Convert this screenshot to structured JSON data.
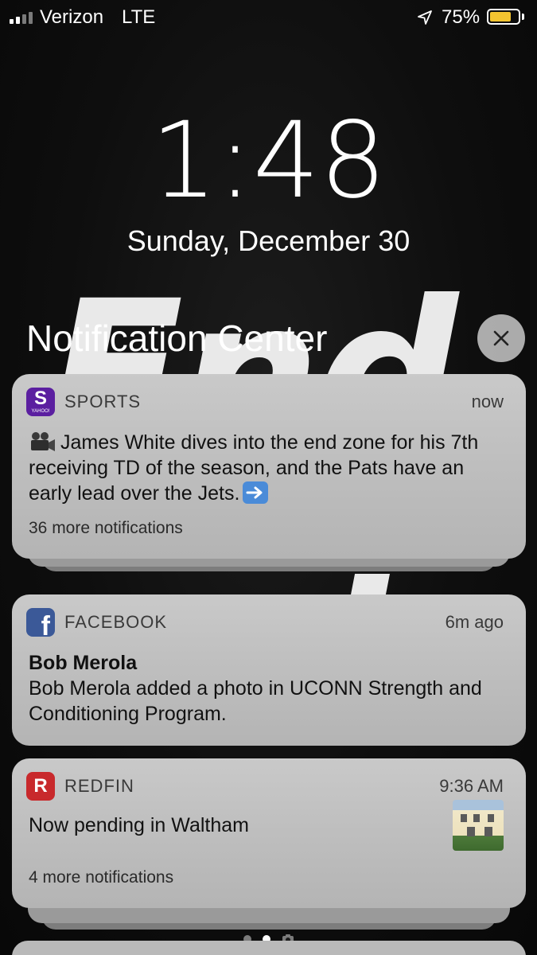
{
  "status_bar": {
    "carrier": "Verizon",
    "network": "LTE",
    "battery_percent": "75%",
    "battery_level": 0.75,
    "battery_color": "#f4c430"
  },
  "lock_screen": {
    "time": "1:48",
    "date": "Sunday, December 30"
  },
  "notification_center": {
    "title": "Notification Center",
    "close_icon": "close-icon"
  },
  "notifications": [
    {
      "app": "SPORTS",
      "icon": "yahoo-sports-icon",
      "icon_letter": "S",
      "icon_sub": "YAHOO!",
      "time": "now",
      "body": "James White dives into the end zone for his 7th receiving TD of the season, and the Pats have an early lead over the Jets.",
      "more": "36 more notifications"
    },
    {
      "app": "FACEBOOK",
      "icon": "facebook-icon",
      "icon_letter": "f",
      "time": "6m ago",
      "title": "Bob Merola",
      "body": "Bob Merola added a photo in UCONN Strength and Conditioning Program."
    },
    {
      "app": "REDFIN",
      "icon": "redfin-icon",
      "icon_letter": "R",
      "time": "9:36 AM",
      "body": "Now pending in Waltham",
      "more": "4 more notifications"
    }
  ],
  "wallpaper": {
    "line1": "End",
    "line2": "ool"
  }
}
